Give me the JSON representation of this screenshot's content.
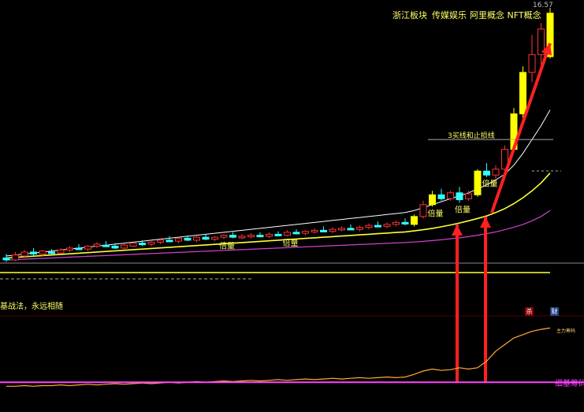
{
  "header": {
    "concepts": [
      "浙江板块",
      "传媒娱乐",
      "阿里概念 NFT概念"
    ],
    "price_high_label": "16.57"
  },
  "subpanel": {
    "strategy_text": "基战法，永远相随",
    "badge_left": "杀",
    "badge_right": "财",
    "indicator_label": "细基筹码",
    "small_note": "主力筹码"
  },
  "colors": {
    "up_candle": "#ff3333",
    "down_candle": "#33ffff",
    "signal_candle": "#ffff00",
    "ma_short": "#ffffff",
    "ma_mid": "#ffff33",
    "ma_long": "#cc44cc",
    "arrow": "#ff2020",
    "indicator_line": "#ff44ff",
    "chip_line": "#ffaa33"
  },
  "chart_data": {
    "type": "candlestick",
    "y_range": [
      3.0,
      16.57
    ],
    "candles": [
      {
        "o": 3.9,
        "h": 4.1,
        "l": 3.7,
        "c": 3.8,
        "t": "d"
      },
      {
        "o": 3.8,
        "h": 4.2,
        "l": 3.75,
        "c": 4.05,
        "t": "u"
      },
      {
        "o": 4.0,
        "h": 4.3,
        "l": 3.9,
        "c": 4.2,
        "t": "u"
      },
      {
        "o": 4.2,
        "h": 4.4,
        "l": 4.0,
        "c": 4.1,
        "t": "d"
      },
      {
        "o": 4.1,
        "h": 4.3,
        "l": 4.0,
        "c": 4.25,
        "t": "u"
      },
      {
        "o": 4.2,
        "h": 4.35,
        "l": 4.05,
        "c": 4.15,
        "t": "d"
      },
      {
        "o": 4.15,
        "h": 4.4,
        "l": 4.1,
        "c": 4.3,
        "t": "u"
      },
      {
        "o": 4.3,
        "h": 4.5,
        "l": 4.2,
        "c": 4.4,
        "t": "u"
      },
      {
        "o": 4.4,
        "h": 4.6,
        "l": 4.3,
        "c": 4.35,
        "t": "d"
      },
      {
        "o": 4.35,
        "h": 4.55,
        "l": 4.25,
        "c": 4.5,
        "t": "u"
      },
      {
        "o": 4.5,
        "h": 4.7,
        "l": 4.4,
        "c": 4.6,
        "t": "u"
      },
      {
        "o": 4.55,
        "h": 4.75,
        "l": 4.45,
        "c": 4.5,
        "t": "d"
      },
      {
        "o": 4.5,
        "h": 4.65,
        "l": 4.35,
        "c": 4.4,
        "t": "d"
      },
      {
        "o": 4.4,
        "h": 4.6,
        "l": 4.3,
        "c": 4.55,
        "t": "u"
      },
      {
        "o": 4.5,
        "h": 4.7,
        "l": 4.45,
        "c": 4.65,
        "t": "u"
      },
      {
        "o": 4.65,
        "h": 4.8,
        "l": 4.5,
        "c": 4.6,
        "t": "d"
      },
      {
        "o": 4.6,
        "h": 4.75,
        "l": 4.5,
        "c": 4.7,
        "t": "u"
      },
      {
        "o": 4.7,
        "h": 4.9,
        "l": 4.6,
        "c": 4.8,
        "t": "u"
      },
      {
        "o": 4.8,
        "h": 5.0,
        "l": 4.7,
        "c": 4.75,
        "t": "d"
      },
      {
        "o": 4.75,
        "h": 4.95,
        "l": 4.65,
        "c": 4.9,
        "t": "u"
      },
      {
        "o": 4.9,
        "h": 5.05,
        "l": 4.75,
        "c": 4.8,
        "t": "d"
      },
      {
        "o": 4.8,
        "h": 5.0,
        "l": 4.7,
        "c": 4.95,
        "t": "u"
      },
      {
        "o": 4.95,
        "h": 5.1,
        "l": 4.8,
        "c": 4.85,
        "t": "d"
      },
      {
        "o": 4.85,
        "h": 5.0,
        "l": 4.75,
        "c": 4.95,
        "t": "u"
      },
      {
        "o": 4.95,
        "h": 5.1,
        "l": 4.85,
        "c": 5.05,
        "t": "u"
      },
      {
        "o": 5.05,
        "h": 5.2,
        "l": 4.9,
        "c": 4.95,
        "t": "d"
      },
      {
        "o": 4.95,
        "h": 5.1,
        "l": 4.85,
        "c": 5.0,
        "t": "u"
      },
      {
        "o": 5.0,
        "h": 5.15,
        "l": 4.9,
        "c": 5.05,
        "t": "u"
      },
      {
        "o": 5.05,
        "h": 5.2,
        "l": 4.95,
        "c": 5.0,
        "t": "d"
      },
      {
        "o": 5.0,
        "h": 5.2,
        "l": 4.9,
        "c": 5.1,
        "t": "u"
      },
      {
        "o": 5.1,
        "h": 5.25,
        "l": 5.0,
        "c": 5.05,
        "t": "d"
      },
      {
        "o": 5.05,
        "h": 5.3,
        "l": 5.0,
        "c": 5.2,
        "t": "u"
      },
      {
        "o": 5.2,
        "h": 5.35,
        "l": 5.1,
        "c": 5.15,
        "t": "d"
      },
      {
        "o": 5.15,
        "h": 5.3,
        "l": 5.05,
        "c": 5.25,
        "t": "u"
      },
      {
        "o": 5.25,
        "h": 5.4,
        "l": 5.15,
        "c": 5.3,
        "t": "u"
      },
      {
        "o": 5.3,
        "h": 5.5,
        "l": 5.2,
        "c": 5.25,
        "t": "d"
      },
      {
        "o": 5.25,
        "h": 5.45,
        "l": 5.15,
        "c": 5.35,
        "t": "u"
      },
      {
        "o": 5.35,
        "h": 5.5,
        "l": 5.25,
        "c": 5.4,
        "t": "u"
      },
      {
        "o": 5.4,
        "h": 5.6,
        "l": 5.3,
        "c": 5.35,
        "t": "d"
      },
      {
        "o": 5.35,
        "h": 5.55,
        "l": 5.25,
        "c": 5.45,
        "t": "u"
      },
      {
        "o": 5.45,
        "h": 5.65,
        "l": 5.35,
        "c": 5.55,
        "t": "u"
      },
      {
        "o": 5.55,
        "h": 5.75,
        "l": 5.45,
        "c": 5.5,
        "t": "d"
      },
      {
        "o": 5.5,
        "h": 5.7,
        "l": 5.4,
        "c": 5.6,
        "t": "u"
      },
      {
        "o": 5.6,
        "h": 5.8,
        "l": 5.5,
        "c": 5.7,
        "t": "u"
      },
      {
        "o": 5.7,
        "h": 5.9,
        "l": 5.55,
        "c": 5.65,
        "t": "d"
      },
      {
        "o": 5.6,
        "h": 6.1,
        "l": 5.5,
        "c": 6.0,
        "t": "s"
      },
      {
        "o": 6.0,
        "h": 6.8,
        "l": 5.9,
        "c": 6.6,
        "t": "u"
      },
      {
        "o": 6.6,
        "h": 7.3,
        "l": 6.5,
        "c": 7.1,
        "t": "s"
      },
      {
        "o": 7.1,
        "h": 7.4,
        "l": 6.8,
        "c": 6.9,
        "t": "d"
      },
      {
        "o": 6.9,
        "h": 7.3,
        "l": 6.8,
        "c": 7.2,
        "t": "u"
      },
      {
        "o": 7.2,
        "h": 7.5,
        "l": 6.7,
        "c": 6.85,
        "t": "d"
      },
      {
        "o": 6.9,
        "h": 7.3,
        "l": 6.8,
        "c": 7.15,
        "t": "u"
      },
      {
        "o": 7.1,
        "h": 8.4,
        "l": 7.0,
        "c": 8.3,
        "t": "s"
      },
      {
        "o": 8.3,
        "h": 8.7,
        "l": 8.0,
        "c": 8.1,
        "t": "d"
      },
      {
        "o": 8.1,
        "h": 8.6,
        "l": 7.9,
        "c": 8.4,
        "t": "u"
      },
      {
        "o": 8.4,
        "h": 9.6,
        "l": 8.3,
        "c": 9.4,
        "t": "u"
      },
      {
        "o": 9.4,
        "h": 11.5,
        "l": 9.3,
        "c": 11.2,
        "t": "s"
      },
      {
        "o": 11.2,
        "h": 13.6,
        "l": 11.0,
        "c": 13.3,
        "t": "s"
      },
      {
        "o": 13.3,
        "h": 15.2,
        "l": 12.8,
        "c": 14.2,
        "t": "u"
      },
      {
        "o": 14.2,
        "h": 15.8,
        "l": 13.7,
        "c": 15.5,
        "t": "u"
      },
      {
        "o": 16.3,
        "h": 16.57,
        "l": 14.0,
        "c": 14.1,
        "t": "s"
      }
    ],
    "ma_short": [
      4.0,
      4.05,
      4.1,
      4.15,
      4.2,
      4.25,
      4.3,
      4.35,
      4.4,
      4.45,
      4.5,
      4.55,
      4.6,
      4.65,
      4.7,
      4.75,
      4.8,
      4.85,
      4.9,
      4.95,
      5.0,
      5.05,
      5.1,
      5.15,
      5.2,
      5.25,
      5.3,
      5.35,
      5.4,
      5.45,
      5.5,
      5.55,
      5.6,
      5.65,
      5.7,
      5.75,
      5.8,
      5.85,
      5.9,
      5.95,
      6.0,
      6.05,
      6.1,
      6.15,
      6.2,
      6.3,
      6.45,
      6.6,
      6.75,
      6.9,
      7.05,
      7.2,
      7.4,
      7.6,
      7.85,
      8.15,
      8.6,
      9.2,
      9.9,
      10.6,
      11.4
    ],
    "ma_mid": [
      3.9,
      3.93,
      3.96,
      3.99,
      4.02,
      4.05,
      4.08,
      4.11,
      4.14,
      4.17,
      4.2,
      4.23,
      4.26,
      4.29,
      4.32,
      4.35,
      4.38,
      4.41,
      4.44,
      4.47,
      4.5,
      4.53,
      4.56,
      4.59,
      4.62,
      4.65,
      4.68,
      4.71,
      4.74,
      4.77,
      4.8,
      4.83,
      4.86,
      4.89,
      4.92,
      4.95,
      4.98,
      5.01,
      5.04,
      5.07,
      5.1,
      5.13,
      5.16,
      5.19,
      5.22,
      5.27,
      5.33,
      5.4,
      5.48,
      5.57,
      5.67,
      5.78,
      5.9,
      6.03,
      6.2,
      6.4,
      6.65,
      6.95,
      7.3,
      7.7,
      8.2
    ],
    "ma_long": [
      3.8,
      3.82,
      3.84,
      3.86,
      3.88,
      3.9,
      3.92,
      3.94,
      3.96,
      3.98,
      4.0,
      4.02,
      4.04,
      4.06,
      4.08,
      4.1,
      4.12,
      4.14,
      4.16,
      4.18,
      4.2,
      4.22,
      4.24,
      4.26,
      4.28,
      4.3,
      4.32,
      4.34,
      4.36,
      4.38,
      4.4,
      4.42,
      4.44,
      4.46,
      4.48,
      4.5,
      4.52,
      4.54,
      4.56,
      4.58,
      4.6,
      4.62,
      4.64,
      4.66,
      4.68,
      4.71,
      4.74,
      4.78,
      4.82,
      4.87,
      4.92,
      4.98,
      5.05,
      5.13,
      5.22,
      5.33,
      5.46,
      5.6,
      5.78,
      6.0,
      6.3
    ],
    "signal_labels": [
      {
        "i": 24,
        "text": "倍量"
      },
      {
        "i": 31,
        "text": "倍量"
      },
      {
        "i": 47,
        "text": "倍量"
      },
      {
        "i": 50,
        "text": "倍量"
      },
      {
        "i": 53,
        "text": "倍量"
      }
    ],
    "resistance": {
      "level": 9.9,
      "from_index": 50,
      "label": "3买线和止损线"
    },
    "indicator": {
      "chip_values": [
        0.02,
        0.02,
        0.03,
        0.02,
        0.03,
        0.03,
        0.04,
        0.03,
        0.04,
        0.05,
        0.04,
        0.05,
        0.06,
        0.05,
        0.06,
        0.07,
        0.06,
        0.07,
        0.08,
        0.07,
        0.08,
        0.09,
        0.08,
        0.09,
        0.1,
        0.09,
        0.1,
        0.11,
        0.1,
        0.11,
        0.12,
        0.11,
        0.12,
        0.13,
        0.12,
        0.13,
        0.14,
        0.13,
        0.14,
        0.15,
        0.14,
        0.15,
        0.16,
        0.15,
        0.16,
        0.2,
        0.25,
        0.28,
        0.26,
        0.27,
        0.3,
        0.28,
        0.3,
        0.4,
        0.55,
        0.65,
        0.75,
        0.8,
        0.85,
        0.88,
        0.9
      ],
      "support_level": 0.08
    }
  }
}
